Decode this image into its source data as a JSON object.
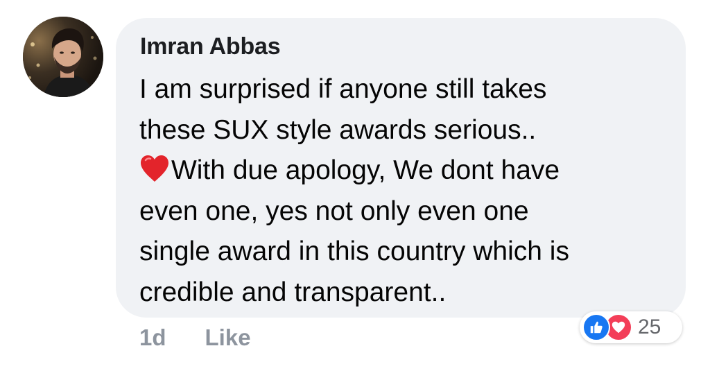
{
  "comment": {
    "author": "Imran Abbas",
    "text_line1": "I am surprised if anyone still takes",
    "text_line2": "these SUX style awards serious..",
    "text_line3": "With due apology, We dont have",
    "text_line4": "even one, yes not only even one",
    "text_line5": "single award in this country which is",
    "text_line6": "credible and transparent..",
    "inline_emoji": "red-heart-icon"
  },
  "actions": {
    "timestamp": "1d",
    "like_label": "Like"
  },
  "reactions": {
    "types": [
      "like-icon",
      "love-icon"
    ],
    "count": "25",
    "like_color": "#1877f2",
    "love_color": "#f33e58"
  },
  "colors": {
    "bubble_bg": "#f0f2f5",
    "secondary_text": "#8d949e"
  }
}
